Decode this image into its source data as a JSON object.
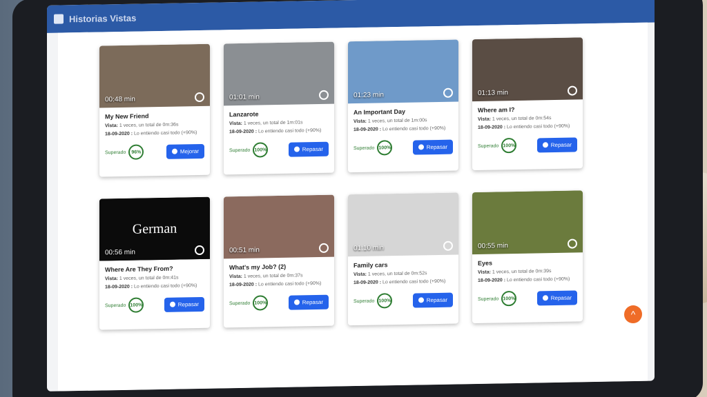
{
  "header": {
    "title": "Historias Vistas"
  },
  "cards": [
    {
      "title": "My New Friend",
      "duration": "00:48 min",
      "vista": "Vista:",
      "vista_text": "1 veces, un total de 0m:36s",
      "date": "18-09-2020 :",
      "date_text": "Lo entiendo casi todo (+90%)",
      "superado": "Superado",
      "percent": "96%",
      "button": "Mejorar",
      "thumb": "#7c6b5a"
    },
    {
      "title": "Lanzarote",
      "duration": "01:01 min",
      "vista": "Vista:",
      "vista_text": "1 veces, un total de 1m:01s",
      "date": "18-09-2020 :",
      "date_text": "Lo entiendo casi todo (+90%)",
      "superado": "Superado",
      "percent": "100%",
      "button": "Repasar",
      "thumb": "#8b8f93"
    },
    {
      "title": "An Important Day",
      "duration": "01:23 min",
      "vista": "Vista:",
      "vista_text": "1 veces, un total de 1m:00s",
      "date": "18-09-2020 :",
      "date_text": "Lo entiendo casi todo (+90%)",
      "superado": "Superado",
      "percent": "100%",
      "button": "Repasar",
      "thumb": "#6f9ac9"
    },
    {
      "title": "Where am I?",
      "duration": "01:13 min",
      "vista": "Vista:",
      "vista_text": "1 veces, un total de 0m:54s",
      "date": "18-09-2020 :",
      "date_text": "Lo entiendo casi todo (+90%)",
      "superado": "Superado",
      "percent": "100%",
      "button": "Repasar",
      "thumb": "#5a4d44"
    },
    {
      "title": "Where Are They From?",
      "duration": "00:56 min",
      "vista": "Vista:",
      "vista_text": "1 veces, un total de 0m:41s",
      "date": "18-09-2020 :",
      "date_text": "Lo entiendo casi todo (+90%)",
      "superado": "Superado",
      "percent": "100%",
      "button": "Repasar",
      "thumb": "#0b0b0b",
      "german": "German"
    },
    {
      "title": "What's my Job? (2)",
      "duration": "00:51 min",
      "vista": "Vista:",
      "vista_text": "1 veces, un total de 0m:37s",
      "date": "18-09-2020 :",
      "date_text": "Lo entiendo casi todo (+90%)",
      "superado": "Superado",
      "percent": "100%",
      "button": "Repasar",
      "thumb": "#8b6a5e"
    },
    {
      "title": "Family cars",
      "duration": "01:10 min",
      "vista": "Vista:",
      "vista_text": "1 veces, un total de 0m:52s",
      "date": "18-09-2020 :",
      "date_text": "Lo entiendo casi todo (+90%)",
      "superado": "Superado",
      "percent": "100%",
      "button": "Repasar",
      "thumb": "#d6d6d6"
    },
    {
      "title": "Eyes",
      "duration": "00:55 min",
      "vista": "Vista:",
      "vista_text": "1 veces, un total de 0m:39s",
      "date": "18-09-2020 :",
      "date_text": "Lo entiendo casi todo (+90%)",
      "superado": "Superado",
      "percent": "100%",
      "button": "Repasar",
      "thumb": "#6b7b3d"
    }
  ]
}
